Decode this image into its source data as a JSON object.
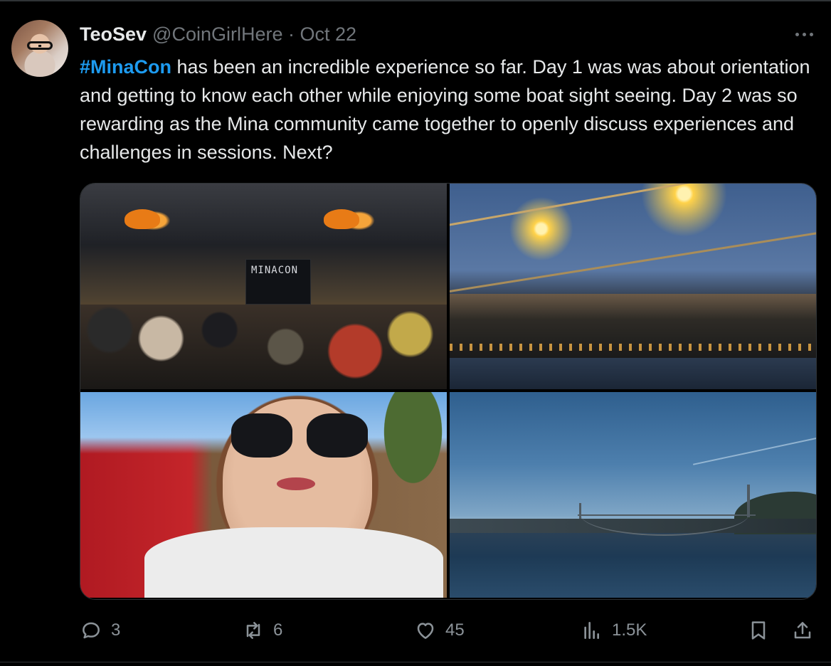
{
  "post": {
    "author_name": "TeoSev",
    "handle_and_date": "@CoinGirlHere · Oct 22",
    "hashtag": "#MinaCon",
    "text": " has been an incredible experience so far. Day  1 was was about orientation and getting to know each other while enjoying some boat sight seeing. Day 2 was so rewarding as the Mina community came together to openly discuss experiences and challenges in sessions. Next?"
  },
  "media": {
    "screen_text": "MINACON"
  },
  "actions": {
    "replies": "3",
    "reposts": "6",
    "likes": "45",
    "views": "1.5K"
  },
  "icons": {
    "reply": "speech-bubble-icon",
    "repost": "repost-arrows-icon",
    "like": "heart-icon",
    "views": "bar-chart-icon",
    "bookmark": "bookmark-icon",
    "share": "share-upload-icon",
    "more": "ellipsis-icon"
  },
  "colors": {
    "background": "#000000",
    "text": "#e7e9ea",
    "secondary_text": "#71767b",
    "hashtag": "#1d9bf0",
    "border": "#2f3336"
  }
}
